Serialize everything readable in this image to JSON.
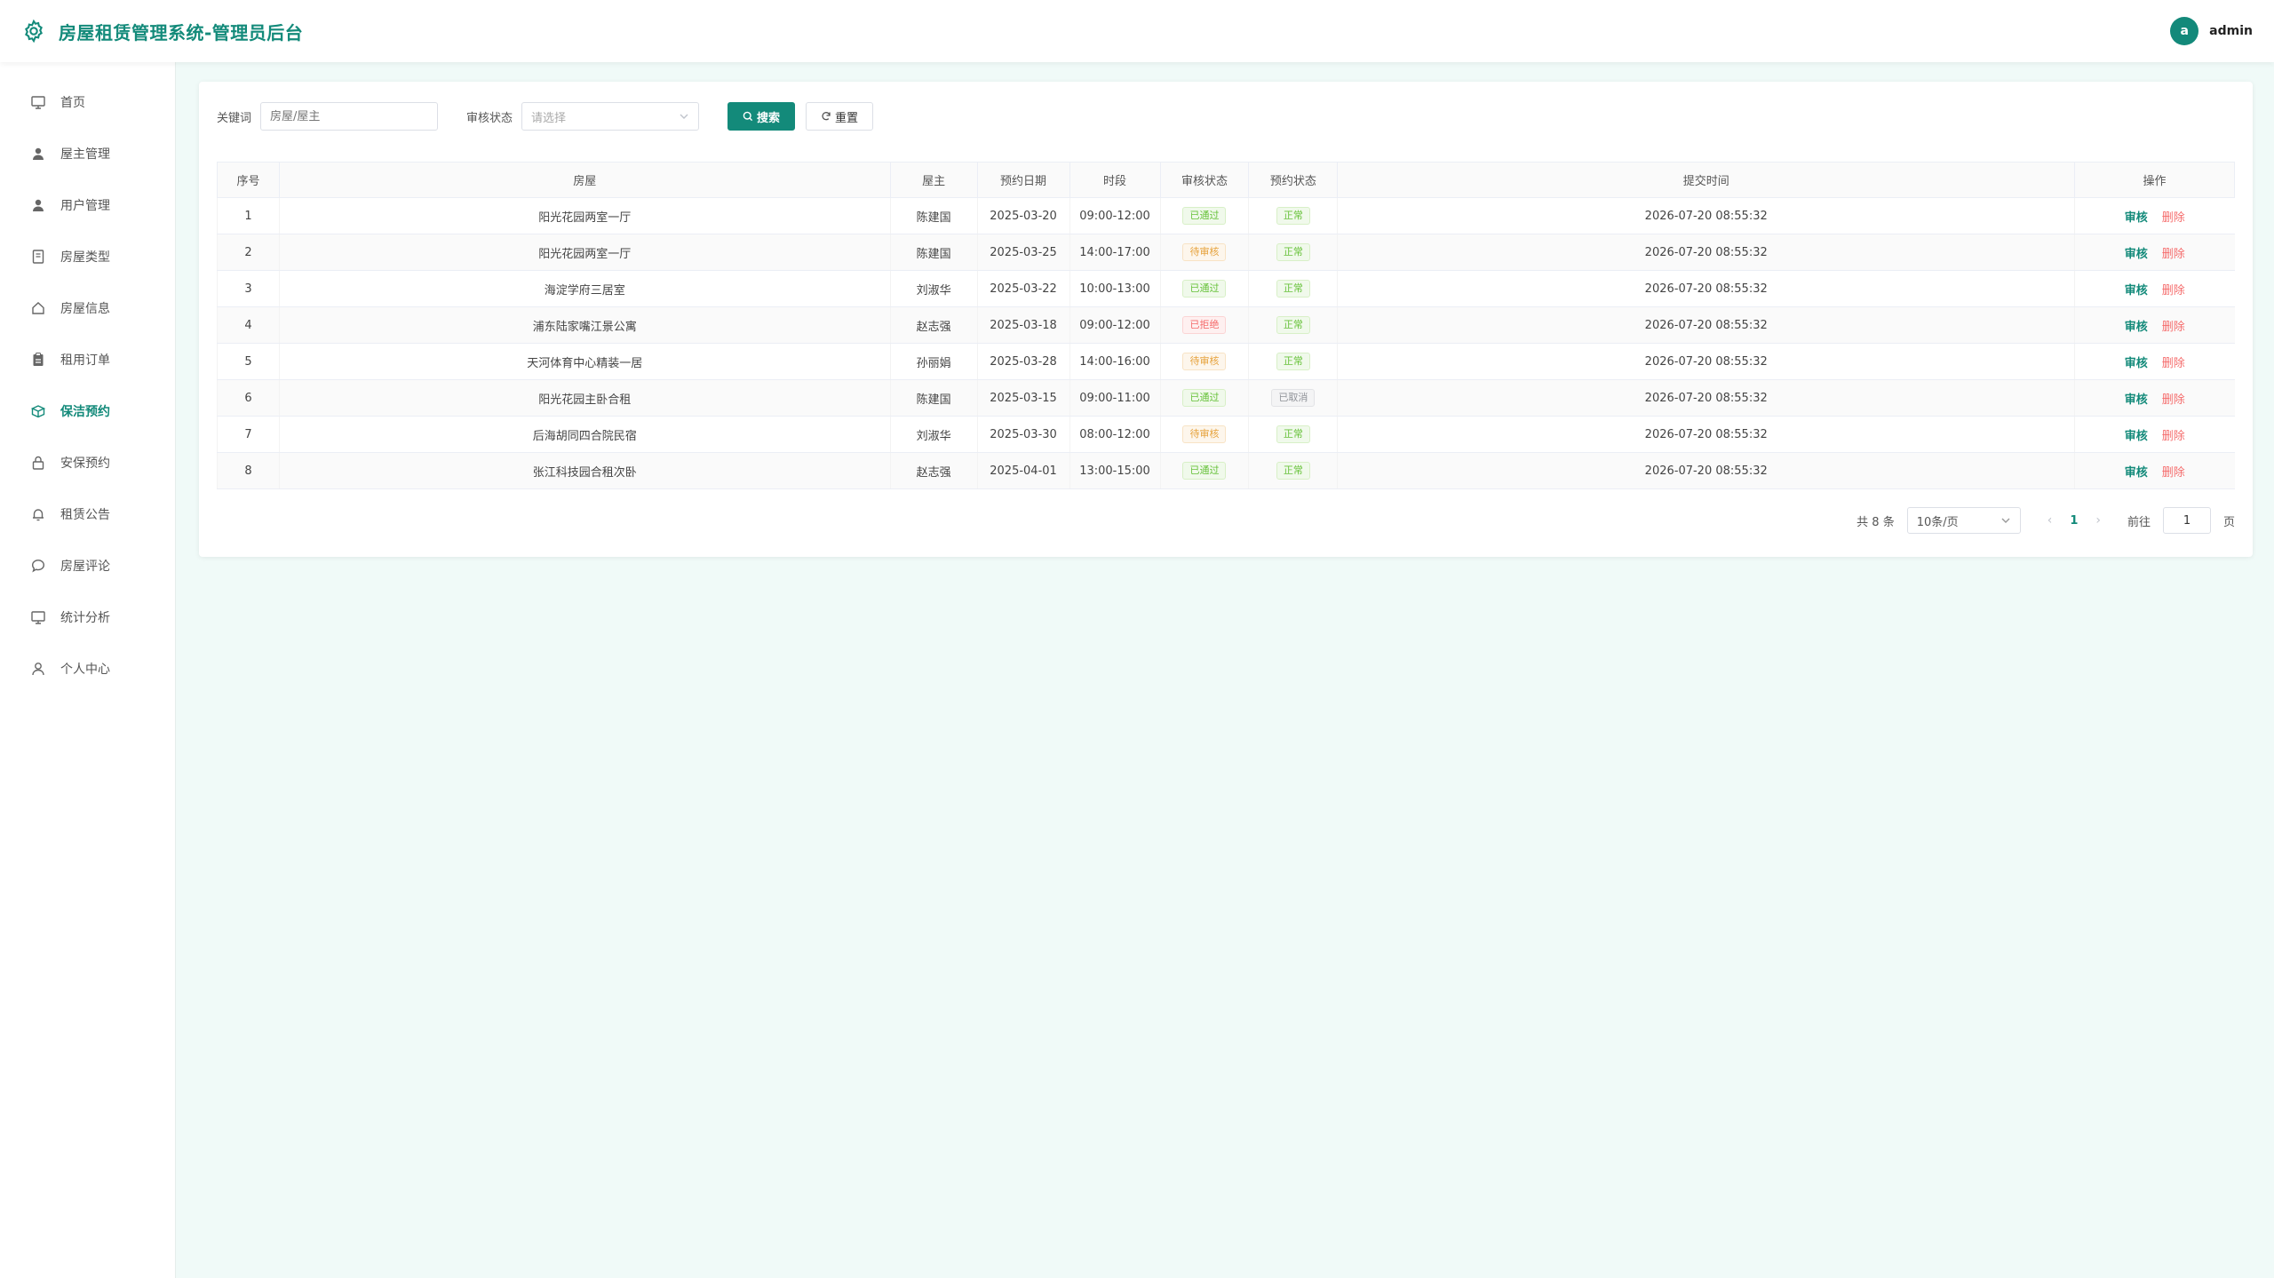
{
  "header": {
    "title": "房屋租赁管理系统-管理员后台",
    "avatar_letter": "a",
    "username": "admin"
  },
  "sidebar": {
    "items": [
      {
        "label": "首页",
        "icon": "monitor-icon"
      },
      {
        "label": "屋主管理",
        "icon": "user-filled-icon"
      },
      {
        "label": "用户管理",
        "icon": "user-filled-icon"
      },
      {
        "label": "房屋类型",
        "icon": "notebook-icon"
      },
      {
        "label": "房屋信息",
        "icon": "house-icon"
      },
      {
        "label": "租用订单",
        "icon": "clipboard-icon"
      },
      {
        "label": "保洁预约",
        "icon": "box-icon",
        "active": true
      },
      {
        "label": "安保预约",
        "icon": "lock-icon"
      },
      {
        "label": "租赁公告",
        "icon": "bell-icon"
      },
      {
        "label": "房屋评论",
        "icon": "chat-icon"
      },
      {
        "label": "统计分析",
        "icon": "monitor-icon"
      },
      {
        "label": "个人中心",
        "icon": "user-icon"
      }
    ]
  },
  "filters": {
    "keyword_label": "关键词",
    "keyword_placeholder": "房屋/屋主",
    "status_label": "审核状态",
    "status_placeholder": "请选择",
    "search_label": "搜索",
    "reset_label": "重置"
  },
  "table": {
    "columns": [
      "序号",
      "房屋",
      "屋主",
      "预约日期",
      "时段",
      "审核状态",
      "预约状态",
      "提交时间",
      "操作"
    ],
    "rows": [
      {
        "no": "1",
        "house": "阳光花园两室一厅",
        "owner": "陈建国",
        "date": "2025-03-20",
        "slot": "09:00-12:00",
        "audit": "已通过",
        "audit_type": "pass",
        "booking": "正常",
        "booking_type": "pass",
        "submitted": "2026-07-20 08:55:32"
      },
      {
        "no": "2",
        "house": "阳光花园两室一厅",
        "owner": "陈建国",
        "date": "2025-03-25",
        "slot": "14:00-17:00",
        "audit": "待审核",
        "audit_type": "wait",
        "booking": "正常",
        "booking_type": "pass",
        "submitted": "2026-07-20 08:55:32"
      },
      {
        "no": "3",
        "house": "海淀学府三居室",
        "owner": "刘淑华",
        "date": "2025-03-22",
        "slot": "10:00-13:00",
        "audit": "已通过",
        "audit_type": "pass",
        "booking": "正常",
        "booking_type": "pass",
        "submitted": "2026-07-20 08:55:32"
      },
      {
        "no": "4",
        "house": "浦东陆家嘴江景公寓",
        "owner": "赵志强",
        "date": "2025-03-18",
        "slot": "09:00-12:00",
        "audit": "已拒绝",
        "audit_type": "reject",
        "booking": "正常",
        "booking_type": "pass",
        "submitted": "2026-07-20 08:55:32"
      },
      {
        "no": "5",
        "house": "天河体育中心精装一居",
        "owner": "孙丽娟",
        "date": "2025-03-28",
        "slot": "14:00-16:00",
        "audit": "待审核",
        "audit_type": "wait",
        "booking": "正常",
        "booking_type": "pass",
        "submitted": "2026-07-20 08:55:32"
      },
      {
        "no": "6",
        "house": "阳光花园主卧合租",
        "owner": "陈建国",
        "date": "2025-03-15",
        "slot": "09:00-11:00",
        "audit": "已通过",
        "audit_type": "pass",
        "booking": "已取消",
        "booking_type": "cancel",
        "submitted": "2026-07-20 08:55:32"
      },
      {
        "no": "7",
        "house": "后海胡同四合院民宿",
        "owner": "刘淑华",
        "date": "2025-03-30",
        "slot": "08:00-12:00",
        "audit": "待审核",
        "audit_type": "wait",
        "booking": "正常",
        "booking_type": "pass",
        "submitted": "2026-07-20 08:55:32"
      },
      {
        "no": "8",
        "house": "张江科技园合租次卧",
        "owner": "赵志强",
        "date": "2025-04-01",
        "slot": "13:00-15:00",
        "audit": "已通过",
        "audit_type": "pass",
        "booking": "正常",
        "booking_type": "pass",
        "submitted": "2026-07-20 08:55:32"
      }
    ],
    "action_review": "审核",
    "action_delete": "删除"
  },
  "pagination": {
    "total_text": "共 8 条",
    "page_size": "10条/页",
    "current_page": "1",
    "goto_label": "前往",
    "goto_value": "1",
    "page_suffix": "页"
  },
  "colors": {
    "accent": "#138a7a",
    "danger": "#f56c6c",
    "background": "#f0faf8"
  }
}
